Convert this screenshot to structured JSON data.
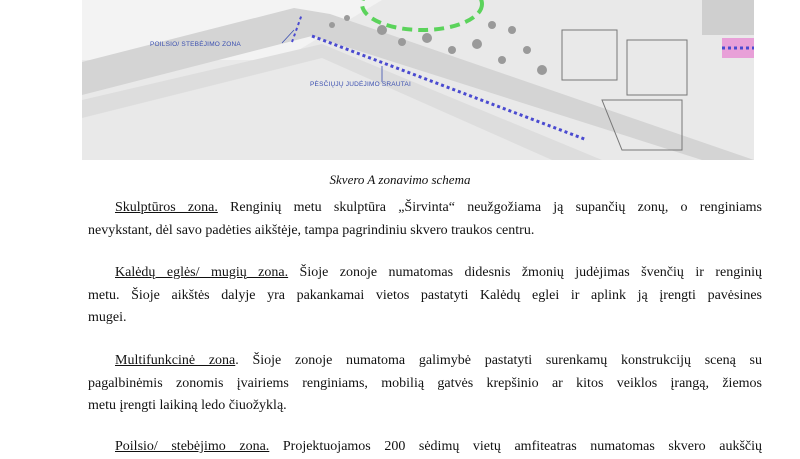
{
  "figure": {
    "labels": {
      "rest_zone": "POILSIO/ STEBĖJIMO ZONA",
      "pedestrian": "PĖSČIŲJŲ JUDĖJIMO SRAUTAI"
    },
    "colors": {
      "background": "#e9e9e9",
      "road_fill": "#d2d2d2",
      "green_circle": "#5bd35b",
      "blue_dots": "#4a4ad0",
      "pink_strip": "#e8a0d8",
      "label_blue": "#3a4fb0"
    }
  },
  "caption": "Skvero A zonavimo schema",
  "paragraphs": [
    {
      "zone_title": "Skulptūros zona.",
      "line1_rest": " Renginių metu skulptūra „Širvinta“ neužgožiama ją supančių zonų, o renginiams",
      "line2": "nevykstant, dėl savo padėties aikštėje, tampa pagrindiniu skvero traukos centru."
    },
    {
      "zone_title": "Kalėdų eglės/ mugių zona.",
      "line1_rest": " Šioje zonoje numatomas didesnis žmonių judėjimas švenčių ir renginių",
      "line2": "metu. Šioje aikštės dalyje yra pakankamai vietos pastatyti Kalėdų eglei ir aplink ją įrengti pavėsines",
      "line3": "mugei."
    },
    {
      "zone_title": "Multifunkcinė zona",
      "line1_rest": ". Šioje zonoje numatoma galimybė pastatyti surenkamų konstrukcijų sceną su",
      "line2": "pagalbinėmis zonomis įvairiems renginiams, mobilią gatvės krepšinio ar kitos veiklos įrangą, žiemos",
      "line3": "metu įrengti laikiną ledo čiuožyklą."
    },
    {
      "zone_title": "Poilsio/ stebėjimo zona.",
      "line1_rest": " Projektuojamos 200 sėdimų vietų amfiteatras numatomas skvero aukščių"
    }
  ]
}
